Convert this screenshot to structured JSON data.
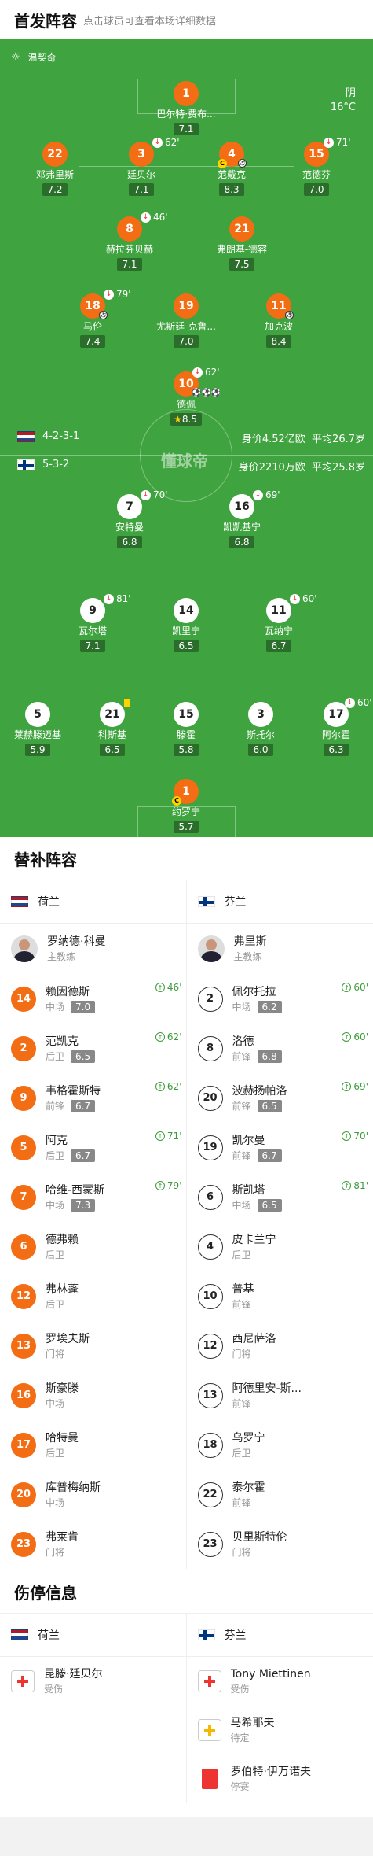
{
  "header": {
    "title": "首发阵容",
    "subtitle": "点击球员可查看本场详细数据"
  },
  "pitch": {
    "referee": "温契奇",
    "weather": {
      "condition": "阴",
      "temp": "16°C"
    },
    "watermark": "懂球帝",
    "home": {
      "name": "荷兰",
      "formation": "4-2-3-1",
      "value": "身价4.52亿欧",
      "age": "平均26.7岁"
    },
    "away": {
      "name": "芬兰",
      "formation": "5-3-2",
      "value": "身价2210万欧",
      "age": "平均25.8岁"
    },
    "home_players": [
      {
        "num": "1",
        "name": "巴尔特·费布...",
        "rating": "7.1"
      },
      {
        "num": "22",
        "name": "邓弗里斯",
        "rating": "7.2"
      },
      {
        "num": "3",
        "name": "廷贝尔",
        "rating": "7.1",
        "sub": "62'"
      },
      {
        "num": "4",
        "name": "范戴克",
        "rating": "8.3",
        "captain": "C"
      },
      {
        "num": "15",
        "name": "范德芬",
        "rating": "7.0",
        "sub": "71'"
      },
      {
        "num": "8",
        "name": "赫拉芬贝赫",
        "rating": "7.1",
        "sub": "46'"
      },
      {
        "num": "21",
        "name": "弗朗基-德容",
        "rating": "7.5"
      },
      {
        "num": "18",
        "name": "马伦",
        "rating": "7.4",
        "sub": "79'"
      },
      {
        "num": "19",
        "name": "尤斯廷-克鲁...",
        "rating": "7.0"
      },
      {
        "num": "11",
        "name": "加克波",
        "rating": "8.4"
      },
      {
        "num": "10",
        "name": "德佩",
        "rating": "8.5",
        "sub": "62'"
      }
    ],
    "away_players": [
      {
        "num": "7",
        "name": "安特曼",
        "rating": "6.8",
        "sub": "70'"
      },
      {
        "num": "16",
        "name": "凯凯基宁",
        "rating": "6.8",
        "sub": "69'"
      },
      {
        "num": "9",
        "name": "瓦尔塔",
        "rating": "7.1",
        "sub": "81'"
      },
      {
        "num": "14",
        "name": "凯里宁",
        "rating": "6.5"
      },
      {
        "num": "11",
        "name": "瓦纳宁",
        "rating": "6.7",
        "sub": "60'"
      },
      {
        "num": "5",
        "name": "莱赫滕迈基",
        "rating": "5.9"
      },
      {
        "num": "21",
        "name": "科斯基",
        "rating": "6.5"
      },
      {
        "num": "15",
        "name": "滕霍",
        "rating": "5.8"
      },
      {
        "num": "3",
        "name": "斯托尔",
        "rating": "6.0"
      },
      {
        "num": "17",
        "name": "阿尔霍",
        "rating": "6.3",
        "sub": "60'"
      },
      {
        "num": "1",
        "name": "约罗宁",
        "rating": "5.7",
        "captain": "C"
      }
    ]
  },
  "subs": {
    "title": "替补阵容",
    "home": {
      "team": "荷兰",
      "coach": "罗纳德·科曼",
      "coach_role": "主教练",
      "players": [
        {
          "num": "14",
          "name": "赖因德斯",
          "pos": "中场",
          "rating": "7.0",
          "min": "46'"
        },
        {
          "num": "2",
          "name": "范凯克",
          "pos": "后卫",
          "rating": "6.5",
          "min": "62'"
        },
        {
          "num": "9",
          "name": "韦格霍斯特",
          "pos": "前锋",
          "rating": "6.7",
          "min": "62'"
        },
        {
          "num": "5",
          "name": "阿克",
          "pos": "后卫",
          "rating": "6.7",
          "min": "71'"
        },
        {
          "num": "7",
          "name": "哈维-西蒙斯",
          "pos": "中场",
          "rating": "7.3",
          "min": "79'"
        },
        {
          "num": "6",
          "name": "德弗赖",
          "pos": "后卫"
        },
        {
          "num": "12",
          "name": "弗林蓬",
          "pos": "后卫"
        },
        {
          "num": "13",
          "name": "罗埃夫斯",
          "pos": "门将"
        },
        {
          "num": "16",
          "name": "斯豪滕",
          "pos": "中场"
        },
        {
          "num": "17",
          "name": "哈特曼",
          "pos": "后卫"
        },
        {
          "num": "20",
          "name": "库普梅纳斯",
          "pos": "中场"
        },
        {
          "num": "23",
          "name": "弗莱肯",
          "pos": "门将"
        }
      ]
    },
    "away": {
      "team": "芬兰",
      "coach": "弗里斯",
      "coach_role": "主教练",
      "players": [
        {
          "num": "2",
          "name": "佩尔托拉",
          "pos": "中场",
          "rating": "6.2",
          "min": "60'"
        },
        {
          "num": "8",
          "name": "洛德",
          "pos": "前锋",
          "rating": "6.8",
          "min": "60'"
        },
        {
          "num": "20",
          "name": "波赫扬帕洛",
          "pos": "前锋",
          "rating": "6.5",
          "min": "69'"
        },
        {
          "num": "19",
          "name": "凯尔曼",
          "pos": "前锋",
          "rating": "6.7",
          "min": "70'"
        },
        {
          "num": "6",
          "name": "斯凯塔",
          "pos": "中场",
          "rating": "6.5",
          "min": "81'"
        },
        {
          "num": "4",
          "name": "皮卡兰宁",
          "pos": "后卫"
        },
        {
          "num": "10",
          "name": "普基",
          "pos": "前锋"
        },
        {
          "num": "12",
          "name": "西尼萨洛",
          "pos": "门将"
        },
        {
          "num": "13",
          "name": "阿德里安-斯...",
          "pos": "前锋"
        },
        {
          "num": "18",
          "name": "乌罗宁",
          "pos": "后卫"
        },
        {
          "num": "22",
          "name": "泰尔霍",
          "pos": "前锋"
        },
        {
          "num": "23",
          "name": "贝里斯特伦",
          "pos": "门将"
        }
      ]
    }
  },
  "injuries": {
    "title": "伤停信息",
    "home": {
      "team": "荷兰",
      "items": [
        {
          "name": "昆滕·廷贝尔",
          "status": "受伤"
        }
      ]
    },
    "away": {
      "team": "芬兰",
      "items": [
        {
          "name": "Tony Miettinen",
          "status": "受伤"
        },
        {
          "name": "马希耶夫",
          "status": "待定"
        },
        {
          "name": "罗伯特·伊万诺夫",
          "status": "停赛"
        }
      ]
    }
  }
}
